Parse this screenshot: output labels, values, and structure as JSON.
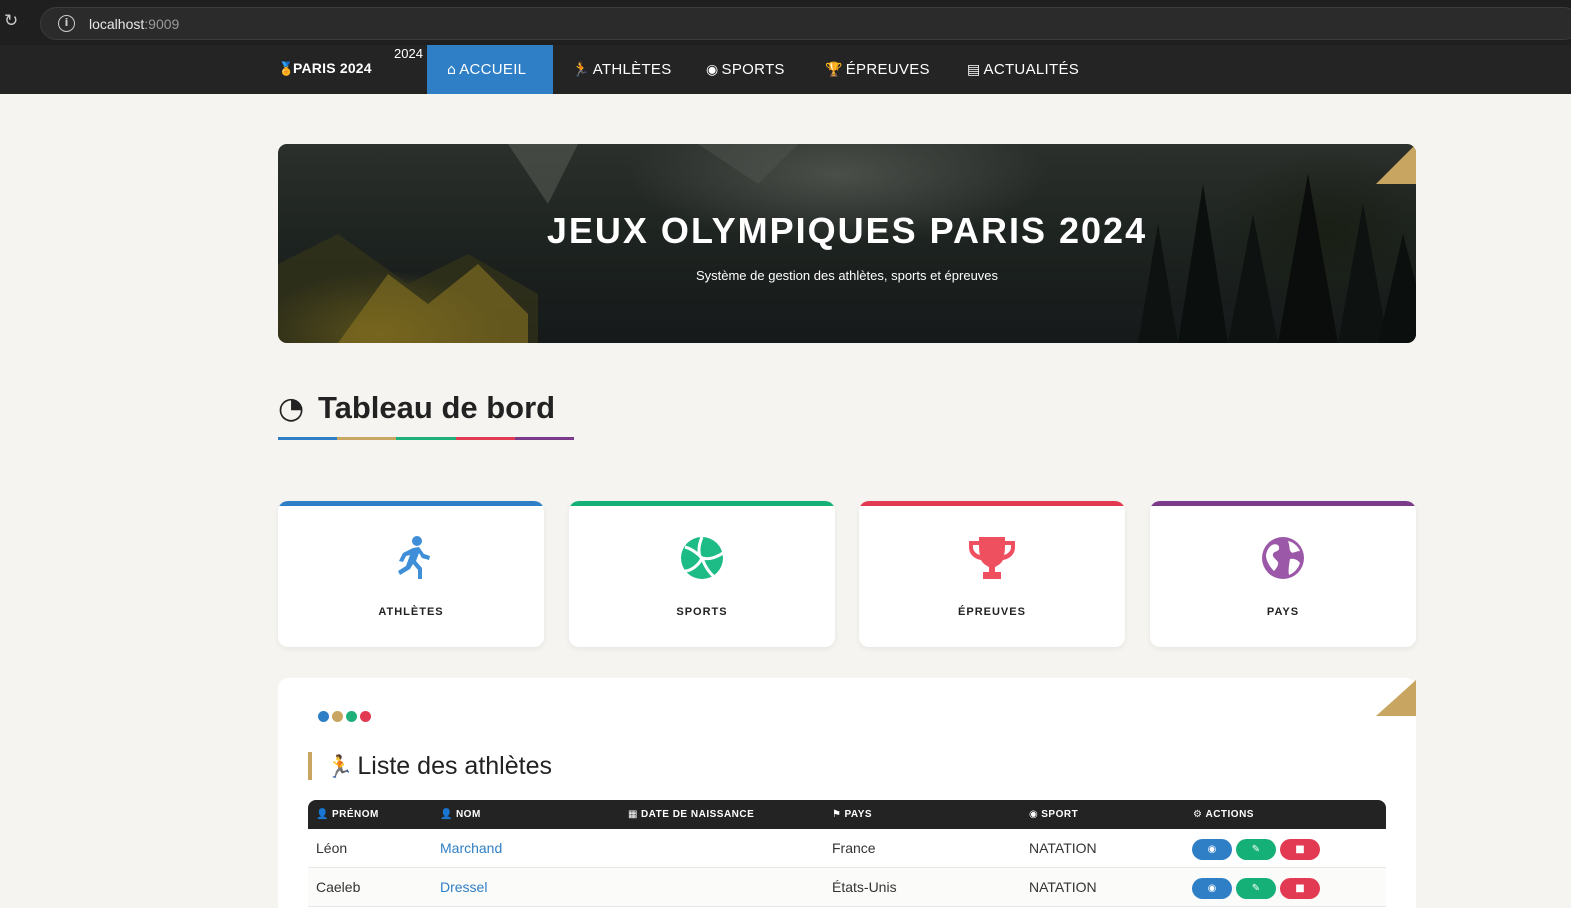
{
  "browser": {
    "url_host": "localhost",
    "url_port": ":9009"
  },
  "navbar": {
    "brand": "PARIS 2024",
    "brand_sup": "2024",
    "items": [
      {
        "label": "ACCUEIL",
        "icon": "home-icon",
        "active": true
      },
      {
        "label": "ATHLÈTES",
        "icon": "running-icon",
        "active": false
      },
      {
        "label": "SPORTS",
        "icon": "volleyball-icon",
        "active": false
      },
      {
        "label": "ÉPREUVES",
        "icon": "trophy-icon",
        "active": false
      },
      {
        "label": "ACTUALITÉS",
        "icon": "newspaper-icon",
        "active": false
      }
    ]
  },
  "hero": {
    "title": "JEUX OLYMPIQUES PARIS 2024",
    "subtitle": "Système de gestion des athlètes, sports et épreuves"
  },
  "dashboard": {
    "title": "Tableau de bord",
    "icon": "tachometer-icon",
    "underline_colors": [
      "#2f7fc6",
      "#c8a560",
      "#1fb07a",
      "#e23a52",
      "#7b3a8a"
    ]
  },
  "cards": [
    {
      "label": "ATHLÈTES",
      "icon": "running-icon",
      "color": "#2f7fc6",
      "icon_color": "#3e8fd8"
    },
    {
      "label": "SPORTS",
      "icon": "volleyball-icon",
      "color": "#14b078",
      "icon_color": "#1dbb86"
    },
    {
      "label": "ÉPREUVES",
      "icon": "trophy-icon",
      "color": "#e23a52",
      "icon_color": "#ef5060"
    },
    {
      "label": "PAYS",
      "icon": "globe-icon",
      "color": "#7b3a8a",
      "icon_color": "#9b58a8"
    }
  ],
  "list": {
    "dots": [
      "#2f7fc6",
      "#c8a560",
      "#1fb07a",
      "#e23a52"
    ],
    "title": "Liste des athlètes",
    "columns": [
      "PRÉNOM",
      "NOM",
      "DATE DE NAISSANCE",
      "PAYS",
      "SPORT",
      "ACTIONS"
    ],
    "rows": [
      {
        "prenom": "Léon",
        "nom": "Marchand",
        "date": "",
        "pays": "France",
        "sport": "NATATION"
      },
      {
        "prenom": "Caeleb",
        "nom": "Dressel",
        "date": "",
        "pays": "États-Unis",
        "sport": "NATATION"
      }
    ],
    "actions": [
      {
        "name": "view",
        "icon": "eye-icon",
        "color": "#2f7fc6"
      },
      {
        "name": "edit",
        "icon": "edit-icon",
        "color": "#14b078"
      },
      {
        "name": "delete",
        "icon": "trash-icon",
        "color": "#e23a52"
      }
    ]
  }
}
